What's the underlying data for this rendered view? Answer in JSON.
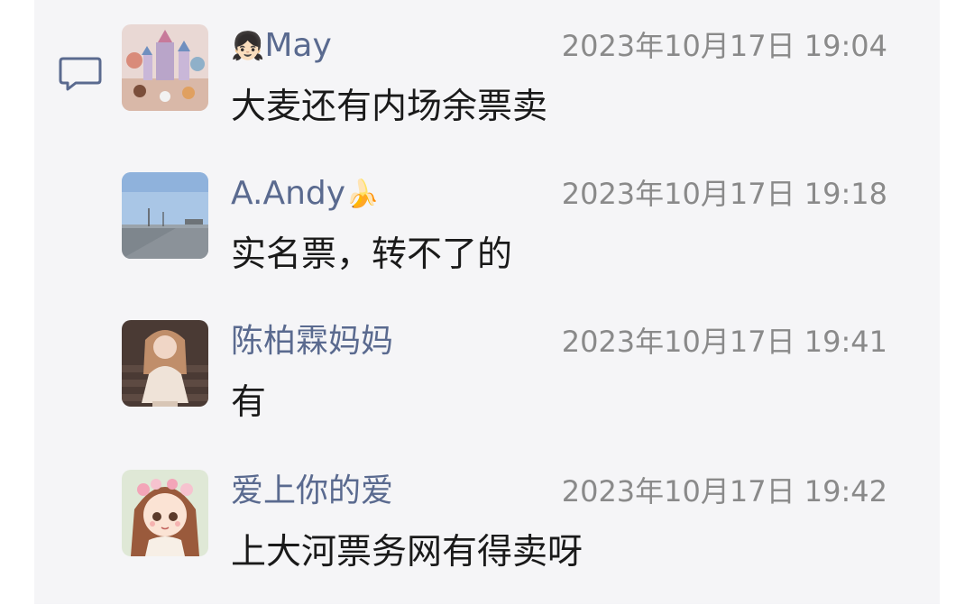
{
  "comments": [
    {
      "name": "May",
      "name_emoji": "👧🏻",
      "time": "2023年10月17日 19:04",
      "text": "大麦还有内场余票卖"
    },
    {
      "name": "A.Andy",
      "name_emoji": "🍌",
      "time": "2023年10月17日 19:18",
      "text": "实名票，转不了的"
    },
    {
      "name": "陈柏霖妈妈",
      "name_emoji": "",
      "time": "2023年10月17日 19:41",
      "text": "有"
    },
    {
      "name": "爱上你的爱",
      "name_emoji": "",
      "time": "2023年10月17日 19:42",
      "text": "上大河票务网有得卖呀"
    }
  ],
  "colors": {
    "name": "#5a6a8f",
    "time": "#8a8a8a",
    "text": "#1a1a1a",
    "background": "#f5f5f7",
    "icon": "#5a6a8f"
  },
  "icons": {
    "comment": "speech-bubble-icon"
  }
}
